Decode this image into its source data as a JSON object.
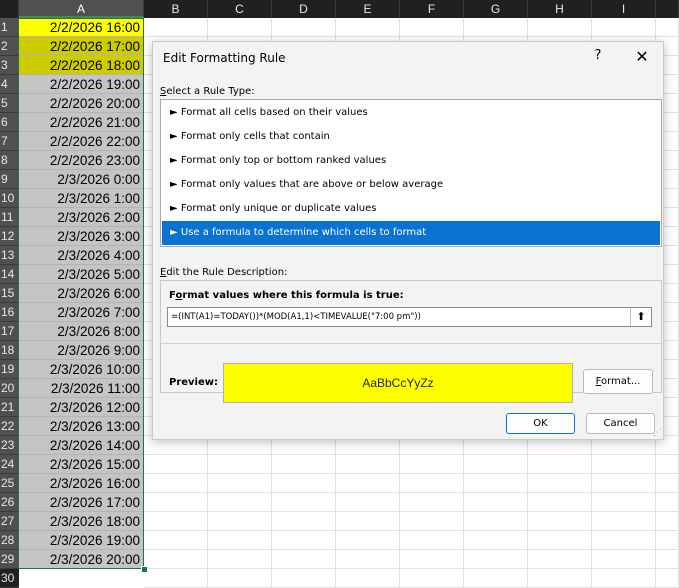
{
  "sheet": {
    "columns": [
      "A",
      "B",
      "C",
      "D",
      "E",
      "F",
      "G",
      "H",
      "I"
    ],
    "rows": [
      {
        "n": "1",
        "value": "2/2/2026 16:00",
        "fill": "#ffff00"
      },
      {
        "n": "2",
        "value": "2/2/2026 17:00",
        "fill": "#cccc00"
      },
      {
        "n": "3",
        "value": "2/2/2026 18:00",
        "fill": "#cccc00"
      },
      {
        "n": "4",
        "value": "2/2/2026 19:00",
        "fill": ""
      },
      {
        "n": "5",
        "value": "2/2/2026 20:00",
        "fill": ""
      },
      {
        "n": "6",
        "value": "2/2/2026 21:00",
        "fill": ""
      },
      {
        "n": "7",
        "value": "2/2/2026 22:00",
        "fill": ""
      },
      {
        "n": "8",
        "value": "2/2/2026 23:00",
        "fill": ""
      },
      {
        "n": "9",
        "value": "2/3/2026 0:00",
        "fill": ""
      },
      {
        "n": "10",
        "value": "2/3/2026 1:00",
        "fill": ""
      },
      {
        "n": "11",
        "value": "2/3/2026 2:00",
        "fill": ""
      },
      {
        "n": "12",
        "value": "2/3/2026 3:00",
        "fill": ""
      },
      {
        "n": "13",
        "value": "2/3/2026 4:00",
        "fill": ""
      },
      {
        "n": "14",
        "value": "2/3/2026 5:00",
        "fill": ""
      },
      {
        "n": "15",
        "value": "2/3/2026 6:00",
        "fill": ""
      },
      {
        "n": "16",
        "value": "2/3/2026 7:00",
        "fill": ""
      },
      {
        "n": "17",
        "value": "2/3/2026 8:00",
        "fill": ""
      },
      {
        "n": "18",
        "value": "2/3/2026 9:00",
        "fill": ""
      },
      {
        "n": "19",
        "value": "2/3/2026 10:00",
        "fill": ""
      },
      {
        "n": "20",
        "value": "2/3/2026 11:00",
        "fill": ""
      },
      {
        "n": "21",
        "value": "2/3/2026 12:00",
        "fill": ""
      },
      {
        "n": "22",
        "value": "2/3/2026 13:00",
        "fill": ""
      },
      {
        "n": "23",
        "value": "2/3/2026 14:00",
        "fill": ""
      },
      {
        "n": "24",
        "value": "2/3/2026 15:00",
        "fill": ""
      },
      {
        "n": "25",
        "value": "2/3/2026 16:00",
        "fill": ""
      },
      {
        "n": "26",
        "value": "2/3/2026 17:00",
        "fill": ""
      },
      {
        "n": "27",
        "value": "2/3/2026 18:00",
        "fill": ""
      },
      {
        "n": "28",
        "value": "2/3/2026 19:00",
        "fill": ""
      },
      {
        "n": "29",
        "value": "2/3/2026 20:00",
        "fill": ""
      },
      {
        "n": "30",
        "value": "",
        "fill": ""
      }
    ],
    "selection": "A1:A29"
  },
  "dialog": {
    "title": "Edit Formatting Rule",
    "help": "?",
    "close": "✕",
    "rule_type_heading_u": "S",
    "rule_type_heading_rest": "elect a Rule Type:",
    "rule_types": [
      {
        "label": "► Format all cells based on their values",
        "selected": false
      },
      {
        "label": "► Format only cells that contain",
        "selected": false
      },
      {
        "label": "► Format only top or bottom ranked values",
        "selected": false
      },
      {
        "label": "► Format only values that are above or below average",
        "selected": false
      },
      {
        "label": "► Format only unique or duplicate values",
        "selected": false
      },
      {
        "label": "► Use a formula to determine which cells to format",
        "selected": true
      }
    ],
    "rule_desc_heading_u": "E",
    "rule_desc_heading_rest": "dit the Rule Description:",
    "formula_label_pre": "F",
    "formula_label_u": "o",
    "formula_label_rest": "rmat values where this formula is true:",
    "formula_value": "=(INT(A1)=TODAY())*(MOD(A1,1)<TIMEVALUE(\"7:00 pm\"))",
    "collapse_icon": "⬆",
    "preview_label": "Preview:",
    "preview_text": "AaBbCcYyZz",
    "preview_fill": "#ffff00",
    "format_button_u": "F",
    "format_button_rest": "ormat...",
    "ok_label": "OK",
    "cancel_label": "Cancel",
    "accent": "#0a73d2"
  }
}
